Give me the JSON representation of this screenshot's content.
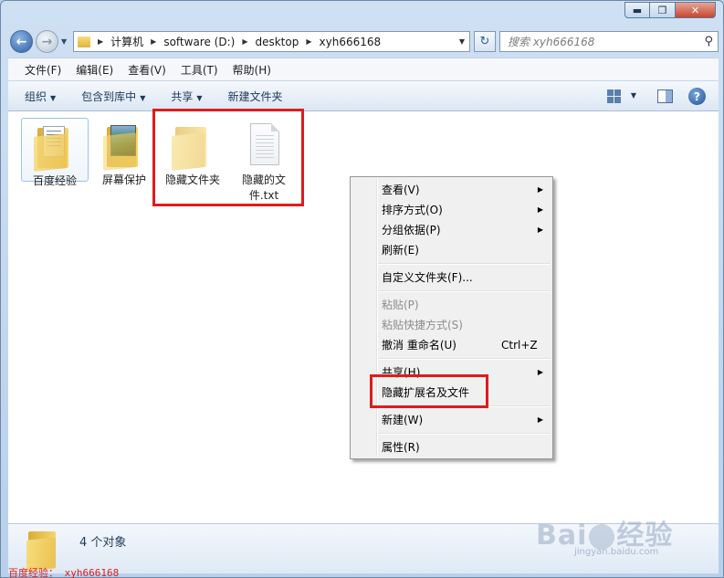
{
  "window": {
    "controls": {
      "minimize": "▬",
      "maximize": "❐",
      "close": "✕"
    }
  },
  "navigation": {
    "back_glyph": "←",
    "forward_glyph": "→",
    "breadcrumb": [
      "计算机",
      "software (D:)",
      "desktop",
      "xyh666168"
    ],
    "search_placeholder": "搜索 xyh666168",
    "refresh_glyph": "↻"
  },
  "menubar": [
    "文件(F)",
    "编辑(E)",
    "查看(V)",
    "工具(T)",
    "帮助(H)"
  ],
  "commandbar": {
    "organize": "组织",
    "include_in_library": "包含到库中",
    "share": "共享",
    "new_folder": "新建文件夹",
    "help": "?"
  },
  "files": [
    {
      "name": "百度经验",
      "icon": "folder-document-icon",
      "selected": true
    },
    {
      "name": "屏幕保护",
      "icon": "folder-picture-icon"
    },
    {
      "name": "隐藏文件夹",
      "icon": "folder-icon"
    },
    {
      "name": "隐藏的文件.txt",
      "name_line1": "隐藏的文",
      "name_line2": "件.txt",
      "icon": "text-file-icon"
    }
  ],
  "context_menu": {
    "view": "查看(V)",
    "sort_by": "排序方式(O)",
    "group_by": "分组依据(P)",
    "refresh": "刷新(E)",
    "customize_folder": "自定义文件夹(F)...",
    "paste": "粘贴(P)",
    "paste_shortcut": "粘贴快捷方式(S)",
    "undo_rename": "撤消 重命名(U)",
    "undo_shortcut": "Ctrl+Z",
    "share_with": "共享(H)",
    "hide_ext_and_files": "隐藏扩展名及文件",
    "new": "新建(W)",
    "properties": "属性(R)"
  },
  "status": {
    "object_count": "4 个对象"
  },
  "watermark": {
    "caption": "百度经验： xyh666168",
    "logo_left": "Bai",
    "logo_right": "经验",
    "url": "jingyan.baidu.com"
  },
  "colors": {
    "highlight_red": "#e01b1b",
    "window_frame": "#b9d0ea"
  }
}
